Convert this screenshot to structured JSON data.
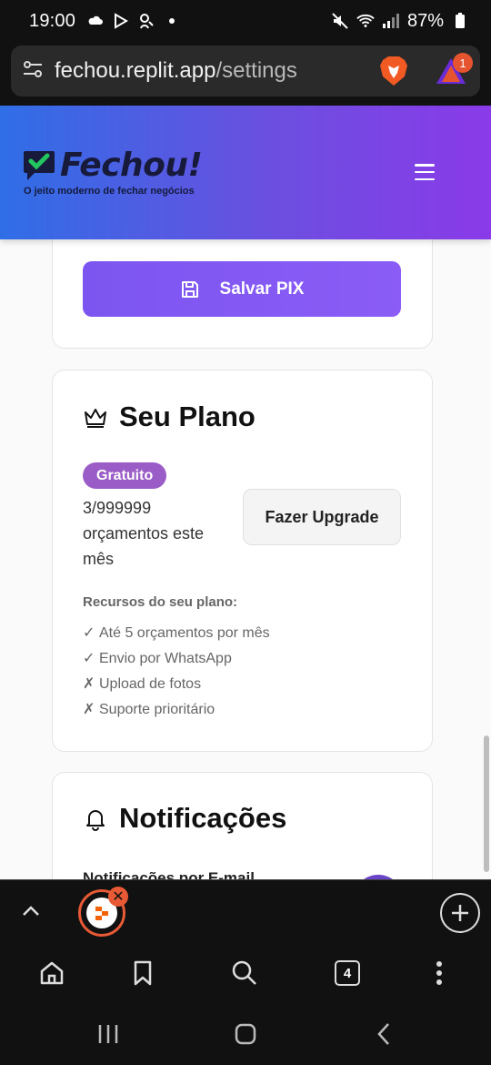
{
  "status_bar": {
    "time": "19:00",
    "battery": "87%"
  },
  "browser": {
    "url_host": "fechou.replit.app",
    "url_path": "/settings",
    "rewards_badge": "1",
    "tab_count": "4"
  },
  "app": {
    "logo_text": "Fechou!",
    "tagline": "O jeito moderno de fechar negócios"
  },
  "pix_card": {
    "save_label": "Salvar PIX"
  },
  "plan_card": {
    "title": "Seu Plano",
    "badge": "Gratuito",
    "usage_line1": "3/999999",
    "usage_line2": "orçamentos este",
    "usage_line3": "mês",
    "upgrade_label": "Fazer Upgrade",
    "features_title": "Recursos do seu plano:",
    "features": [
      {
        "mark": "✓",
        "text": "Até 5 orçamentos por mês"
      },
      {
        "mark": "✓",
        "text": "Envio por WhatsApp"
      },
      {
        "mark": "✗",
        "text": "Upload de fotos"
      },
      {
        "mark": "✗",
        "text": "Suporte prioritário"
      }
    ]
  },
  "notif_card": {
    "title": "Notificações",
    "subtitle": "Notificações por E-mail"
  },
  "colors": {
    "primary": "#8b5cf6",
    "header_start": "#2f6ee6",
    "header_end": "#8a3ae8",
    "badge": "#9a5cc6",
    "brave_orange": "#e85a35"
  }
}
